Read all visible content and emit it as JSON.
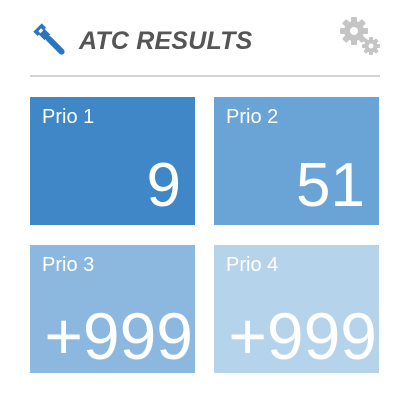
{
  "header": {
    "title": "ATC RESULTS",
    "title_icon": "wrench-icon",
    "settings_icon": "gear-icon"
  },
  "colors": {
    "wrench": "#2b74c2",
    "gear": "#c5c5c5",
    "title": "#555555",
    "divider": "#d4d4d4",
    "prio1": "#3f87c7",
    "prio2": "#6aa3d5",
    "prio3": "#8cb8e0",
    "prio4": "#b6d3ec"
  },
  "tiles": [
    {
      "label": "Prio 1",
      "value": "9"
    },
    {
      "label": "Prio 2",
      "value": "51"
    },
    {
      "label": "Prio 3",
      "value": "+999"
    },
    {
      "label": "Prio 4",
      "value": "+999"
    }
  ]
}
